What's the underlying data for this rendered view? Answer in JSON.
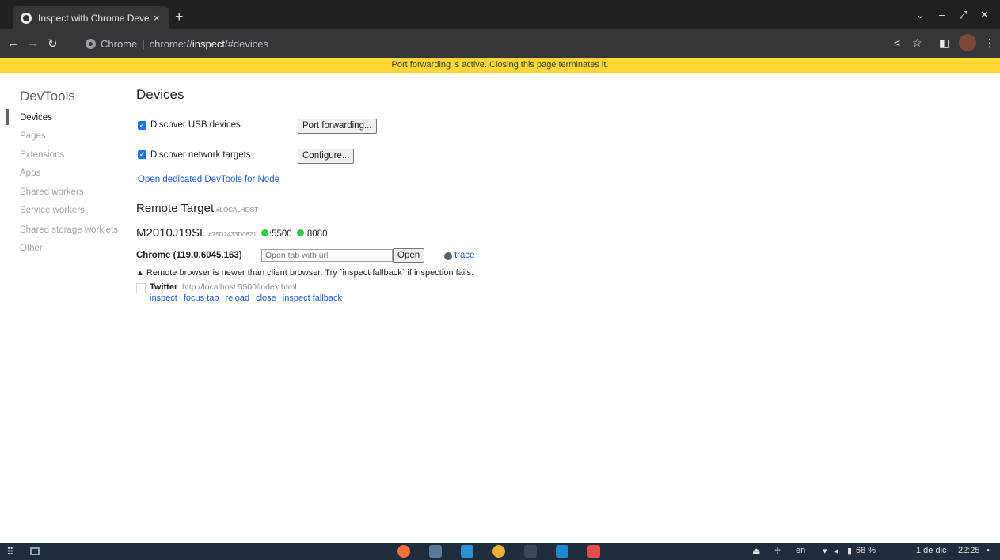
{
  "browser": {
    "tab_title": "Inspect with Chrome Developer Tools",
    "tab_close": "×",
    "new_tab": "+",
    "omnibox_scheme_label": "Chrome",
    "omnibox_separator": "|",
    "url_prefix": "chrome://",
    "url_strong": "inspect",
    "url_suffix": "/#devices"
  },
  "banner": {
    "text": "Port forwarding is active. Closing this page terminates it."
  },
  "sidebar": {
    "title": "DevTools",
    "items": [
      {
        "label": "Devices",
        "active": true
      },
      {
        "label": "Pages"
      },
      {
        "label": "Extensions"
      },
      {
        "label": "Apps"
      },
      {
        "label": "Shared workers"
      },
      {
        "label": "Service workers"
      },
      {
        "label": "Shared storage worklets"
      },
      {
        "label": "Other"
      }
    ]
  },
  "main": {
    "title": "Devices",
    "usb_label": "Discover USB devices",
    "usb_checked": true,
    "port_forwarding_button": "Port forwarding...",
    "network_label": "Discover network targets",
    "network_checked": true,
    "configure_button": "Configure...",
    "node_link": "Open dedicated DevTools for Node",
    "remote_title": "Remote Target",
    "remote_sub": "#LOCALHOST",
    "device": {
      "name": "M2010J19SL",
      "serial": "#75D2433D0621",
      "ports": [
        ":5500",
        ":8080"
      ]
    },
    "browser_name": "Chrome (119.0.6045.163)",
    "open_tab_placeholder": "Open tab with url",
    "open_button": "Open",
    "trace_link": "trace",
    "warning_icon": "▲",
    "warning": "Remote browser is newer than client browser. Try `inspect fallback` if inspection fails.",
    "page": {
      "title": "Twitter",
      "url": "http://localhost:5500/index.html",
      "actions": [
        "inspect",
        "focus tab",
        "reload",
        "close",
        "inspect fallback"
      ]
    }
  },
  "taskbar": {
    "keyboard_layout": "en",
    "battery": "68 %",
    "date": "1 de dic",
    "time": "22:25"
  },
  "colors": {
    "banner": "#fdd835",
    "link": "#1a5bd6",
    "checkbox": "#1a73e8",
    "port_dot": "#2ecc40",
    "tabstrip": "#202124",
    "toolbar": "#35363a"
  }
}
